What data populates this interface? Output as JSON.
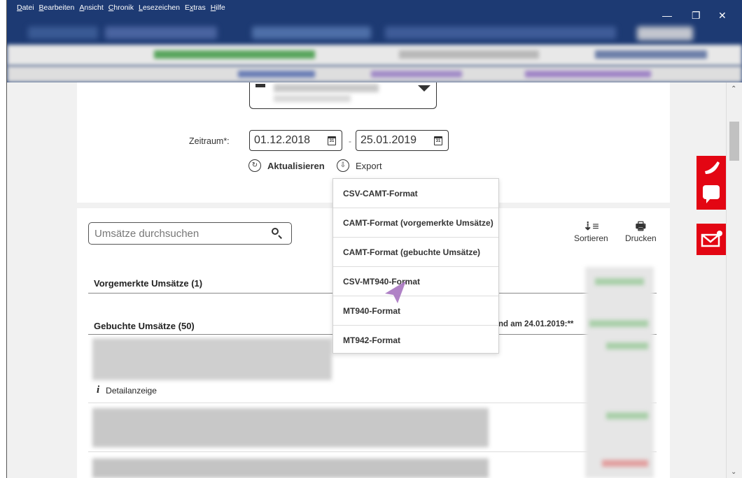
{
  "menubar": {
    "items": [
      {
        "prefix": "",
        "accel": "D",
        "rest": "atei"
      },
      {
        "prefix": "",
        "accel": "B",
        "rest": "earbeiten"
      },
      {
        "prefix": "",
        "accel": "A",
        "rest": "nsicht"
      },
      {
        "prefix": "",
        "accel": "C",
        "rest": "hronik"
      },
      {
        "prefix": "",
        "accel": "L",
        "rest": "esezeichen"
      },
      {
        "prefix": "E",
        "accel": "x",
        "rest": "tras"
      },
      {
        "prefix": "",
        "accel": "H",
        "rest": "ilfe"
      }
    ]
  },
  "window_controls": {
    "minimize": "—",
    "restore": "❐",
    "close": "✕"
  },
  "filter": {
    "zeitraum_label": "Zeitraum*:",
    "from_date": "01.12.2018",
    "to_date": "25.01.2019",
    "date_separator": "-",
    "calendar_day": "31",
    "refresh_label": "Aktualisieren",
    "export_label": "Export"
  },
  "search": {
    "placeholder": "Umsätze durchsuchen"
  },
  "toolbar": {
    "sort_label": "Sortieren",
    "print_label": "Drucken"
  },
  "sections": {
    "pending_title": "Vorgemerkte Umsätze (1)",
    "booked_title": "Gebuchte Umsätze (50)",
    "saldo_text": "nd am 24.01.2019:**",
    "detail_label": "Detailanzeige"
  },
  "export_menu": {
    "items": [
      "CSV-CAMT-Format",
      "CAMT-Format (vorgemerkte Umsätze)",
      "CAMT-Format (gebuchte Umsätze)",
      "CSV-MT940-Format",
      "MT940-Format",
      "MT942-Format"
    ]
  },
  "colors": {
    "brand_red": "#e30613",
    "titlebar": "#1d3a73",
    "cursor": "#a774c0"
  },
  "icons": [
    "phone-icon",
    "chat-icon",
    "mail-icon",
    "calendar-icon",
    "refresh-icon",
    "download-icon",
    "search-icon",
    "sort-icon",
    "printer-icon",
    "info-icon"
  ]
}
